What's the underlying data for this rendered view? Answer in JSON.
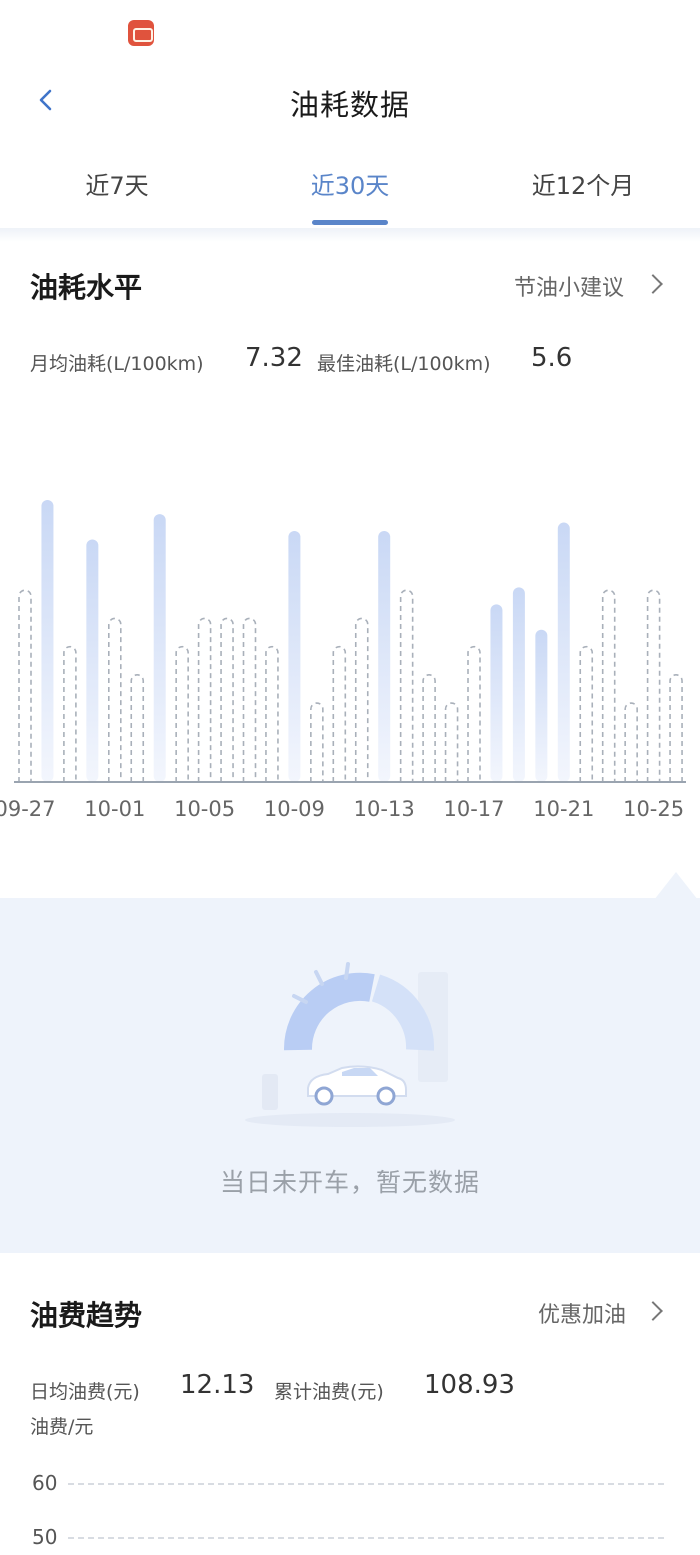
{
  "header": {
    "title": "油耗数据"
  },
  "tabs": [
    {
      "label": "近7天",
      "active": false
    },
    {
      "label": "近30天",
      "active": true
    },
    {
      "label": "近12个月",
      "active": false
    }
  ],
  "consumption": {
    "title": "油耗水平",
    "link_label": "节油小建议",
    "avg_label": "月均油耗(L/100km)",
    "avg_value": "7.32",
    "best_label": "最佳油耗(L/100km)",
    "best_value": "5.6"
  },
  "chart_data": {
    "type": "bar",
    "x_tick_labels": [
      "09-27",
      "10-01",
      "10-05",
      "10-09",
      "10-13",
      "10-17",
      "10-21",
      "10-25"
    ],
    "bars": [
      {
        "value": 0.68,
        "type": "dashed"
      },
      {
        "value": 1.0,
        "type": "solid"
      },
      {
        "value": 0.48,
        "type": "dashed"
      },
      {
        "value": 0.86,
        "type": "solid"
      },
      {
        "value": 0.58,
        "type": "dashed"
      },
      {
        "value": 0.38,
        "type": "dashed"
      },
      {
        "value": 0.95,
        "type": "solid"
      },
      {
        "value": 0.48,
        "type": "dashed"
      },
      {
        "value": 0.58,
        "type": "dashed"
      },
      {
        "value": 0.58,
        "type": "dashed"
      },
      {
        "value": 0.58,
        "type": "dashed"
      },
      {
        "value": 0.48,
        "type": "dashed"
      },
      {
        "value": 0.89,
        "type": "solid"
      },
      {
        "value": 0.28,
        "type": "dashed"
      },
      {
        "value": 0.48,
        "type": "dashed"
      },
      {
        "value": 0.58,
        "type": "dashed"
      },
      {
        "value": 0.89,
        "type": "solid"
      },
      {
        "value": 0.68,
        "type": "dashed"
      },
      {
        "value": 0.38,
        "type": "dashed"
      },
      {
        "value": 0.28,
        "type": "dashed"
      },
      {
        "value": 0.48,
        "type": "dashed"
      },
      {
        "value": 0.63,
        "type": "solid"
      },
      {
        "value": 0.69,
        "type": "solid"
      },
      {
        "value": 0.54,
        "type": "solid"
      },
      {
        "value": 0.92,
        "type": "solid"
      },
      {
        "value": 0.48,
        "type": "dashed"
      },
      {
        "value": 0.68,
        "type": "dashed"
      },
      {
        "value": 0.28,
        "type": "dashed"
      },
      {
        "value": 0.68,
        "type": "dashed"
      },
      {
        "value": 0.38,
        "type": "dashed"
      }
    ],
    "colors": {
      "solid_top": "#c9d8f5",
      "solid_bottom": "#f3f6fd",
      "dashed": "#a9b0ba",
      "axis": "#9aa4b0"
    }
  },
  "empty_state": {
    "message": "当日未开车，暂无数据"
  },
  "fuel_cost": {
    "title": "油费趋势",
    "link_label": "优惠加油",
    "avg_label": "日均油费(元)",
    "avg_value": "12.13",
    "total_label": "累计油费(元)",
    "total_value": "108.93",
    "y_axis_label": "油费/元",
    "y_ticks": [
      "60",
      "50"
    ]
  }
}
